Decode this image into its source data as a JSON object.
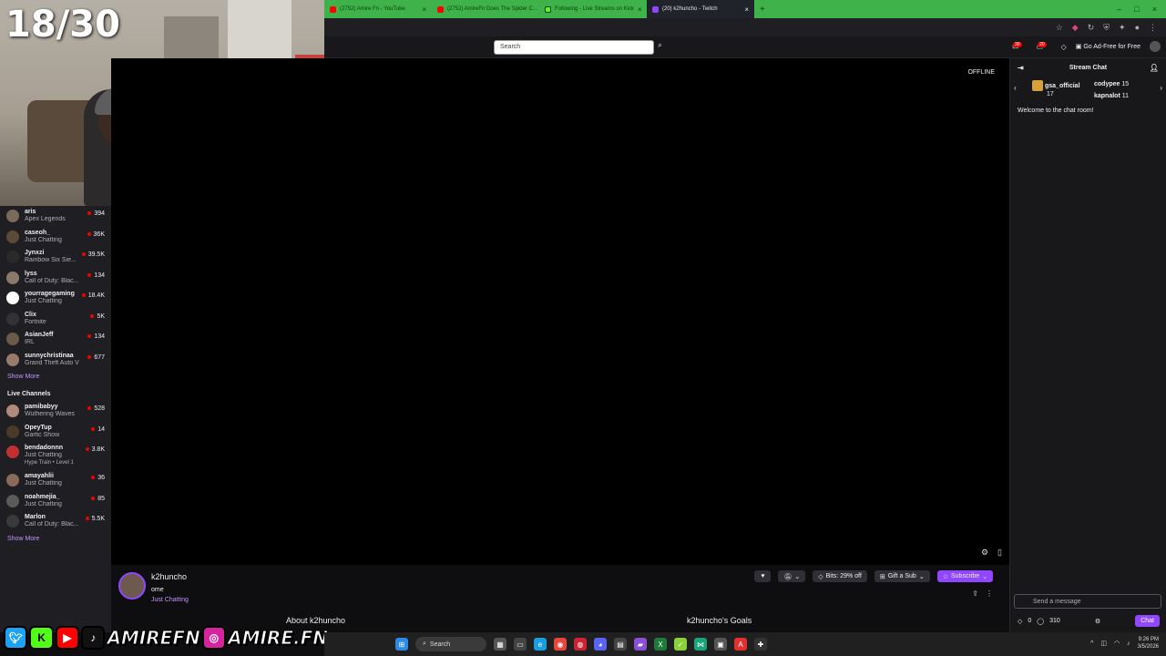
{
  "overlay": {
    "counter": "18/30",
    "handle_primary": "AMIREFN",
    "handle_instagram": "AMIRE.FN"
  },
  "browser": {
    "tabs": [
      {
        "label": "(2752) Amire Fn - YouTube",
        "color": "#ff0000"
      },
      {
        "label": "(2752) AmireFn Does The Spider C...",
        "color": "#ff0000"
      },
      {
        "label": "Following - Live Streams on Kick",
        "color": "#53fc18"
      },
      {
        "label": "(20) k2huncho - Twitch",
        "color": "#9147ff",
        "active": true
      }
    ],
    "new_tab": "+"
  },
  "nav": {
    "search_placeholder": "Search",
    "notif_count": "30",
    "whisper_count": "20",
    "ad_free": "Go Ad-Free for Free"
  },
  "sidebar": {
    "followed": [
      {
        "name": "aris",
        "game": "Apex Legends",
        "viewers": "394",
        "color": "#7a6a5a"
      },
      {
        "name": "caseoh_",
        "game": "Just Chatting",
        "viewers": "36K",
        "color": "#5a4a3a"
      },
      {
        "name": "Jynxzi",
        "game": "Rainbow Six Sie...",
        "viewers": "39.5K",
        "color": "#2a2a2a"
      },
      {
        "name": "lyss",
        "game": "Call of Duty: Blac...",
        "viewers": "134",
        "color": "#8a7a6a"
      },
      {
        "name": "yourragegaming",
        "game": "Just Chatting",
        "viewers": "18.4K",
        "color": "#ffffff"
      },
      {
        "name": "Clix",
        "game": "Fortnite",
        "viewers": "5K",
        "color": "#333333"
      },
      {
        "name": "AsianJeff",
        "game": "IRL",
        "viewers": "134",
        "color": "#6a5a4a"
      },
      {
        "name": "sunnychristinaa",
        "game": "Grand Theft Auto V",
        "viewers": "677",
        "color": "#9a7a6a"
      }
    ],
    "show_more": "Show More",
    "live_heading": "Live Channels",
    "live": [
      {
        "name": "pamibabyy",
        "game": "Wuthering Waves",
        "viewers": "528",
        "color": "#b08a7a"
      },
      {
        "name": "OpeyTup",
        "game": "Gartic Show",
        "viewers": "14",
        "color": "#4a3a2a"
      },
      {
        "name": "bendadonnn",
        "game": "Just Chatting",
        "viewers": "3.8K",
        "color": "#c03030",
        "hype": "Hype Train • Level 1"
      },
      {
        "name": "amayahlii",
        "game": "Just Chatting",
        "viewers": "36",
        "color": "#8a6a5a"
      },
      {
        "name": "noahmejia_",
        "game": "Just Chatting",
        "viewers": "85",
        "color": "#5a5a5a"
      },
      {
        "name": "Marlon",
        "game": "Call of Duty: Blac...",
        "viewers": "5.5K",
        "color": "#3a3a3a"
      }
    ],
    "show_more2": "Show More"
  },
  "player": {
    "status": "OFFLINE"
  },
  "channel": {
    "name": "k2huncho",
    "title": "ome",
    "category": "Just Chatting",
    "bits": "Bits: 29% off",
    "gift": "Gift a Sub",
    "subscribe": "Subscribe",
    "about": "About k2huncho",
    "goals": "k2huncho's Goals"
  },
  "chat": {
    "title": "Stream Chat",
    "gifters": [
      {
        "name": "gsa_official",
        "count": "17"
      },
      {
        "name": "codypee",
        "count": "15"
      },
      {
        "name": "kapnalot",
        "count": "11"
      }
    ],
    "welcome": "Welcome to the chat room!",
    "input_placeholder": "Send a message",
    "points": "0",
    "channel_points": "310",
    "chat_button": "Chat"
  },
  "taskbar": {
    "search": "Search",
    "time": "9:26 PM",
    "date": "3/5/2026"
  }
}
